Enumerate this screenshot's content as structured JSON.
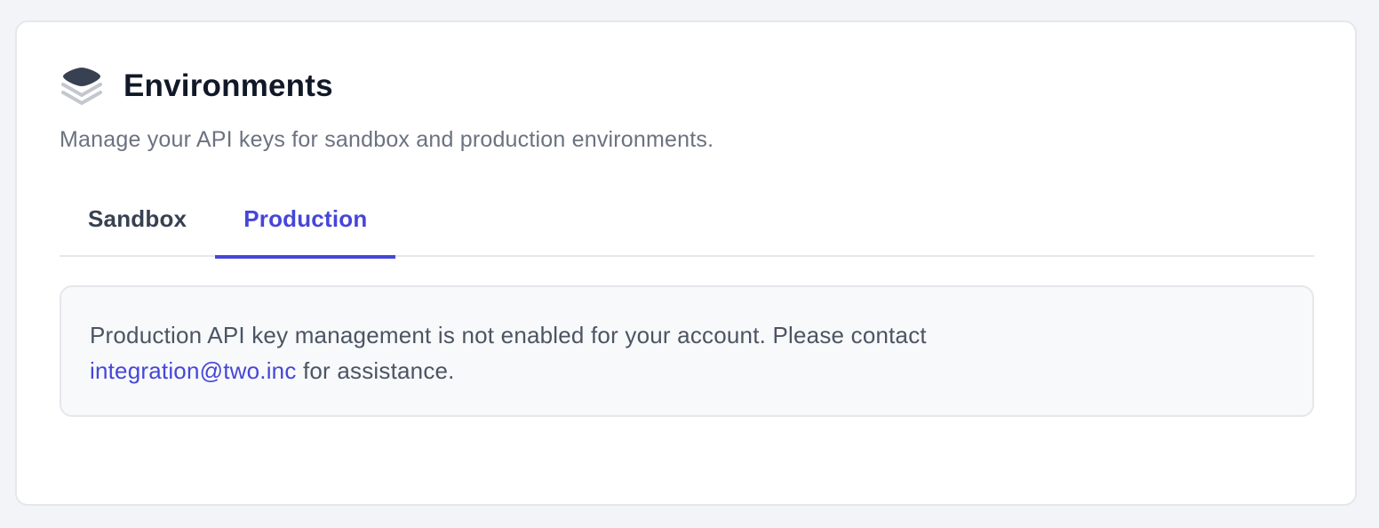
{
  "section": {
    "icon": "layers-icon",
    "title": "Environments",
    "subtitle": "Manage your API keys for sandbox and production environments."
  },
  "tabs": [
    {
      "label": "Sandbox",
      "active": false
    },
    {
      "label": "Production",
      "active": true
    }
  ],
  "notice": {
    "text_before": "Production API key management is not enabled for your account. Please contact",
    "email": "integration@two.inc",
    "text_after": " for assistance."
  },
  "colors": {
    "accent": "#4646d9",
    "title": "#111827",
    "muted": "#6b7280",
    "icon_dark": "#374151",
    "icon_light": "#c4c7ce"
  }
}
